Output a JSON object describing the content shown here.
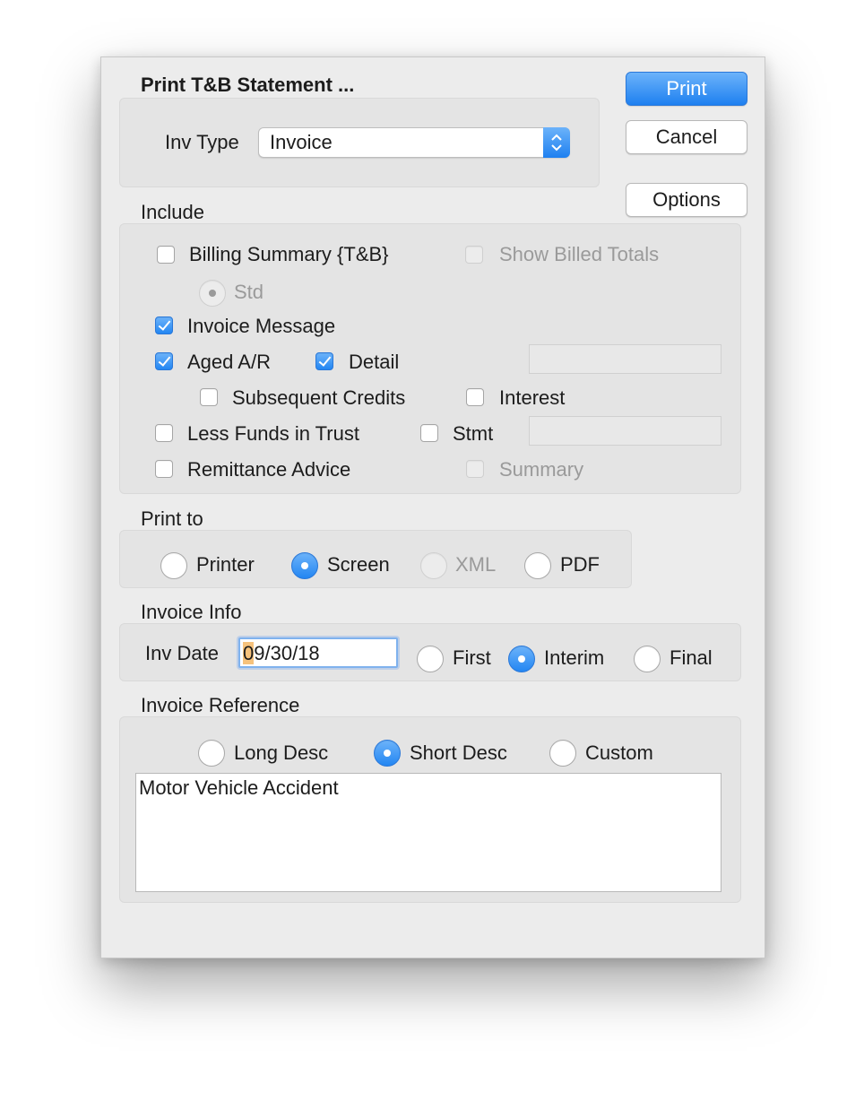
{
  "dialog": {
    "title": "Print T&B Statement ...",
    "buttons": {
      "print": "Print",
      "cancel": "Cancel",
      "options": "Options"
    },
    "inv_type": {
      "label": "Inv Type",
      "selected": "Invoice"
    },
    "include": {
      "label": "Include",
      "billing_summary": {
        "label": "Billing Summary {T&B}",
        "checked": false
      },
      "show_billed_totals": {
        "label": "Show Billed Totals",
        "checked": false,
        "disabled": true
      },
      "std": {
        "label": "Std",
        "selected": true,
        "disabled": true
      },
      "invoice_message": {
        "label": "Invoice Message",
        "checked": true
      },
      "aged_ar": {
        "label": "Aged A/R",
        "checked": true
      },
      "detail": {
        "label": "Detail",
        "checked": true
      },
      "subsequent_credits": {
        "label": "Subsequent Credits",
        "checked": false
      },
      "interest": {
        "label": "Interest",
        "checked": false
      },
      "less_funds_in_trust": {
        "label": "Less Funds in Trust",
        "checked": false
      },
      "stmt": {
        "label": "Stmt",
        "checked": false
      },
      "remittance_advice": {
        "label": "Remittance Advice",
        "checked": false
      },
      "summary": {
        "label": "Summary",
        "checked": false,
        "disabled": true
      }
    },
    "print_to": {
      "label": "Print to",
      "options": [
        "Printer",
        "Screen",
        "XML",
        "PDF"
      ],
      "selected": "Screen"
    },
    "invoice_info": {
      "label": "Invoice Info",
      "inv_date_label": "Inv Date",
      "inv_date_highlight": "0",
      "inv_date_rest": "9/30/18",
      "options": [
        "First",
        "Interim",
        "Final"
      ],
      "selected": "Interim"
    },
    "invoice_reference": {
      "label": "Invoice Reference",
      "options": [
        "Long Desc",
        "Short Desc",
        "Custom"
      ],
      "selected": "Short Desc",
      "text": "Motor Vehicle Accident"
    }
  },
  "colors": {
    "accent": "#2386f2",
    "dialog_bg": "#ececec",
    "disabled_text": "#9a9a9a"
  }
}
